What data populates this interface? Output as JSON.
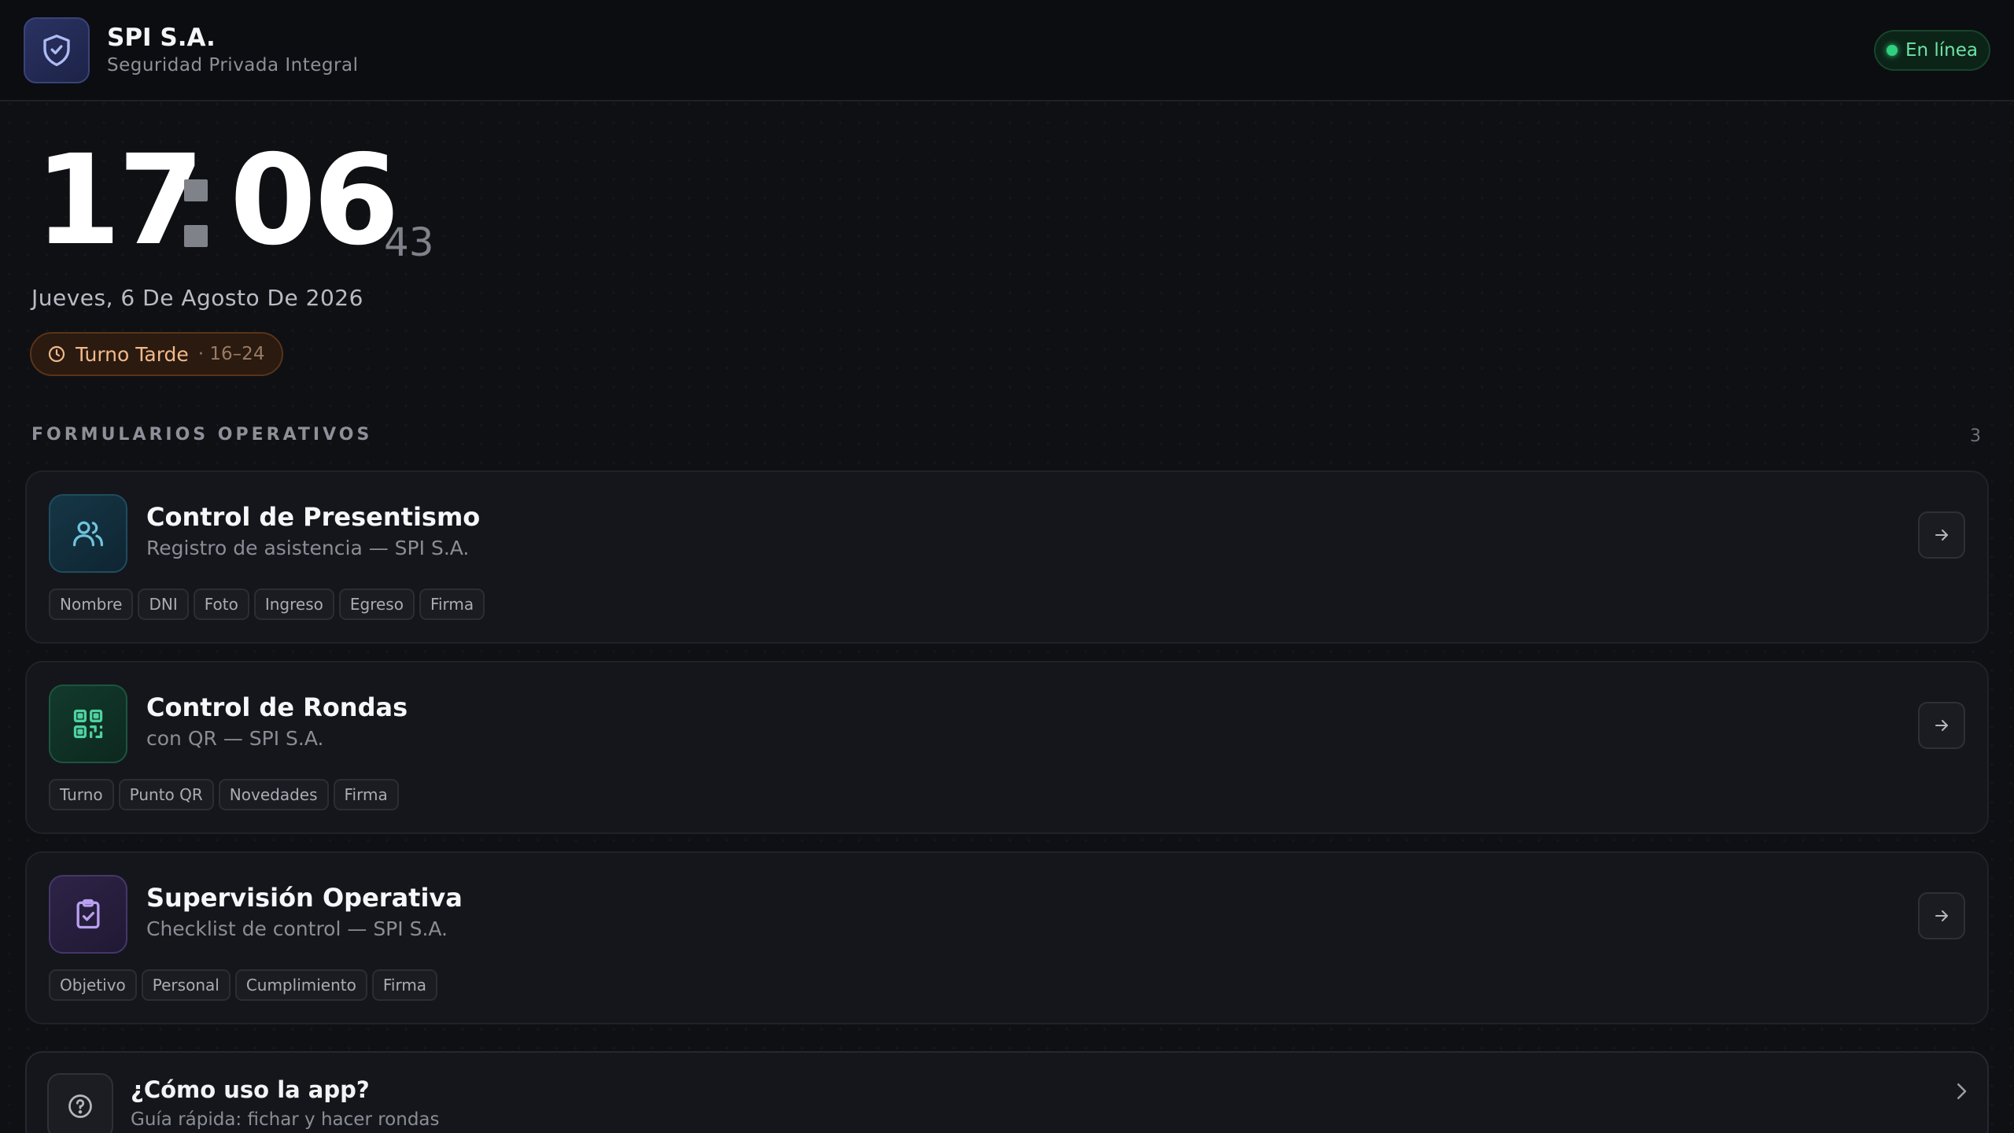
{
  "header": {
    "brand_name": "SPI S.A.",
    "brand_subtitle": "Seguridad Privada Integral",
    "status": "En línea"
  },
  "clock": {
    "hours": "17",
    "minutes": "06",
    "seconds": "43",
    "date": "Jueves, 6 De Agosto De 2026"
  },
  "shift": {
    "label": "Turno Tarde",
    "hours": "· 16–24"
  },
  "section": {
    "title": "FORMULARIOS OPERATIVOS",
    "count": "3"
  },
  "forms": [
    {
      "title": "Control de Presentismo",
      "subtitle": "Registro de asistencia — SPI S.A.",
      "icon": "users-icon",
      "tags": [
        "Nombre",
        "DNI",
        "Foto",
        "Ingreso",
        "Egreso",
        "Firma"
      ]
    },
    {
      "title": "Control de Rondas",
      "subtitle": "con QR — SPI S.A.",
      "icon": "qr-code-icon",
      "tags": [
        "Turno",
        "Punto QR",
        "Novedades",
        "Firma"
      ]
    },
    {
      "title": "Supervisión Operativa",
      "subtitle": "Checklist de control — SPI S.A.",
      "icon": "clipboard-check-icon",
      "tags": [
        "Objetivo",
        "Personal",
        "Cumplimiento",
        "Firma"
      ]
    }
  ],
  "help": {
    "title": "¿Cómo uso la app?",
    "subtitle": "Guía rápida: fichar y hacer rondas"
  },
  "colors": {
    "background": "#0f1014",
    "status_green": "#2fd07e",
    "shift_orange": "#f2b98a",
    "teal": "#6fc3dc",
    "green": "#4fd1a0",
    "purple": "#b9a0f0"
  }
}
